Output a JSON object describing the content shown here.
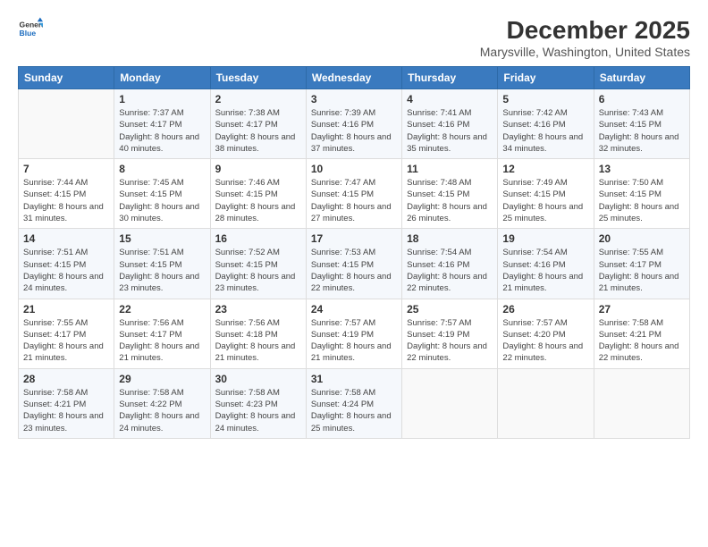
{
  "header": {
    "title": "December 2025",
    "subtitle": "Marysville, Washington, United States"
  },
  "columns": [
    "Sunday",
    "Monday",
    "Tuesday",
    "Wednesday",
    "Thursday",
    "Friday",
    "Saturday"
  ],
  "weeks": [
    [
      {
        "day": "",
        "sunrise": "",
        "sunset": "",
        "daylight": ""
      },
      {
        "day": "1",
        "sunrise": "Sunrise: 7:37 AM",
        "sunset": "Sunset: 4:17 PM",
        "daylight": "Daylight: 8 hours and 40 minutes."
      },
      {
        "day": "2",
        "sunrise": "Sunrise: 7:38 AM",
        "sunset": "Sunset: 4:17 PM",
        "daylight": "Daylight: 8 hours and 38 minutes."
      },
      {
        "day": "3",
        "sunrise": "Sunrise: 7:39 AM",
        "sunset": "Sunset: 4:16 PM",
        "daylight": "Daylight: 8 hours and 37 minutes."
      },
      {
        "day": "4",
        "sunrise": "Sunrise: 7:41 AM",
        "sunset": "Sunset: 4:16 PM",
        "daylight": "Daylight: 8 hours and 35 minutes."
      },
      {
        "day": "5",
        "sunrise": "Sunrise: 7:42 AM",
        "sunset": "Sunset: 4:16 PM",
        "daylight": "Daylight: 8 hours and 34 minutes."
      },
      {
        "day": "6",
        "sunrise": "Sunrise: 7:43 AM",
        "sunset": "Sunset: 4:15 PM",
        "daylight": "Daylight: 8 hours and 32 minutes."
      }
    ],
    [
      {
        "day": "7",
        "sunrise": "Sunrise: 7:44 AM",
        "sunset": "Sunset: 4:15 PM",
        "daylight": "Daylight: 8 hours and 31 minutes."
      },
      {
        "day": "8",
        "sunrise": "Sunrise: 7:45 AM",
        "sunset": "Sunset: 4:15 PM",
        "daylight": "Daylight: 8 hours and 30 minutes."
      },
      {
        "day": "9",
        "sunrise": "Sunrise: 7:46 AM",
        "sunset": "Sunset: 4:15 PM",
        "daylight": "Daylight: 8 hours and 28 minutes."
      },
      {
        "day": "10",
        "sunrise": "Sunrise: 7:47 AM",
        "sunset": "Sunset: 4:15 PM",
        "daylight": "Daylight: 8 hours and 27 minutes."
      },
      {
        "day": "11",
        "sunrise": "Sunrise: 7:48 AM",
        "sunset": "Sunset: 4:15 PM",
        "daylight": "Daylight: 8 hours and 26 minutes."
      },
      {
        "day": "12",
        "sunrise": "Sunrise: 7:49 AM",
        "sunset": "Sunset: 4:15 PM",
        "daylight": "Daylight: 8 hours and 25 minutes."
      },
      {
        "day": "13",
        "sunrise": "Sunrise: 7:50 AM",
        "sunset": "Sunset: 4:15 PM",
        "daylight": "Daylight: 8 hours and 25 minutes."
      }
    ],
    [
      {
        "day": "14",
        "sunrise": "Sunrise: 7:51 AM",
        "sunset": "Sunset: 4:15 PM",
        "daylight": "Daylight: 8 hours and 24 minutes."
      },
      {
        "day": "15",
        "sunrise": "Sunrise: 7:51 AM",
        "sunset": "Sunset: 4:15 PM",
        "daylight": "Daylight: 8 hours and 23 minutes."
      },
      {
        "day": "16",
        "sunrise": "Sunrise: 7:52 AM",
        "sunset": "Sunset: 4:15 PM",
        "daylight": "Daylight: 8 hours and 23 minutes."
      },
      {
        "day": "17",
        "sunrise": "Sunrise: 7:53 AM",
        "sunset": "Sunset: 4:15 PM",
        "daylight": "Daylight: 8 hours and 22 minutes."
      },
      {
        "day": "18",
        "sunrise": "Sunrise: 7:54 AM",
        "sunset": "Sunset: 4:16 PM",
        "daylight": "Daylight: 8 hours and 22 minutes."
      },
      {
        "day": "19",
        "sunrise": "Sunrise: 7:54 AM",
        "sunset": "Sunset: 4:16 PM",
        "daylight": "Daylight: 8 hours and 21 minutes."
      },
      {
        "day": "20",
        "sunrise": "Sunrise: 7:55 AM",
        "sunset": "Sunset: 4:17 PM",
        "daylight": "Daylight: 8 hours and 21 minutes."
      }
    ],
    [
      {
        "day": "21",
        "sunrise": "Sunrise: 7:55 AM",
        "sunset": "Sunset: 4:17 PM",
        "daylight": "Daylight: 8 hours and 21 minutes."
      },
      {
        "day": "22",
        "sunrise": "Sunrise: 7:56 AM",
        "sunset": "Sunset: 4:17 PM",
        "daylight": "Daylight: 8 hours and 21 minutes."
      },
      {
        "day": "23",
        "sunrise": "Sunrise: 7:56 AM",
        "sunset": "Sunset: 4:18 PM",
        "daylight": "Daylight: 8 hours and 21 minutes."
      },
      {
        "day": "24",
        "sunrise": "Sunrise: 7:57 AM",
        "sunset": "Sunset: 4:19 PM",
        "daylight": "Daylight: 8 hours and 21 minutes."
      },
      {
        "day": "25",
        "sunrise": "Sunrise: 7:57 AM",
        "sunset": "Sunset: 4:19 PM",
        "daylight": "Daylight: 8 hours and 22 minutes."
      },
      {
        "day": "26",
        "sunrise": "Sunrise: 7:57 AM",
        "sunset": "Sunset: 4:20 PM",
        "daylight": "Daylight: 8 hours and 22 minutes."
      },
      {
        "day": "27",
        "sunrise": "Sunrise: 7:58 AM",
        "sunset": "Sunset: 4:21 PM",
        "daylight": "Daylight: 8 hours and 22 minutes."
      }
    ],
    [
      {
        "day": "28",
        "sunrise": "Sunrise: 7:58 AM",
        "sunset": "Sunset: 4:21 PM",
        "daylight": "Daylight: 8 hours and 23 minutes."
      },
      {
        "day": "29",
        "sunrise": "Sunrise: 7:58 AM",
        "sunset": "Sunset: 4:22 PM",
        "daylight": "Daylight: 8 hours and 24 minutes."
      },
      {
        "day": "30",
        "sunrise": "Sunrise: 7:58 AM",
        "sunset": "Sunset: 4:23 PM",
        "daylight": "Daylight: 8 hours and 24 minutes."
      },
      {
        "day": "31",
        "sunrise": "Sunrise: 7:58 AM",
        "sunset": "Sunset: 4:24 PM",
        "daylight": "Daylight: 8 hours and 25 minutes."
      },
      {
        "day": "",
        "sunrise": "",
        "sunset": "",
        "daylight": ""
      },
      {
        "day": "",
        "sunrise": "",
        "sunset": "",
        "daylight": ""
      },
      {
        "day": "",
        "sunrise": "",
        "sunset": "",
        "daylight": ""
      }
    ]
  ]
}
